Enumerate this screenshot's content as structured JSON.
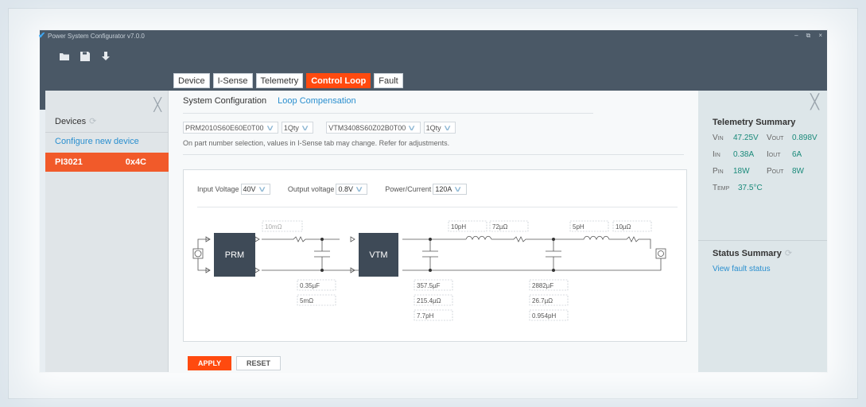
{
  "window": {
    "title": "Power System Configurator v7.0.0",
    "controls": [
      "–",
      "⧉",
      "×"
    ]
  },
  "toolbar": {
    "icons": [
      "folder-open-icon",
      "save-icon",
      "download-icon"
    ]
  },
  "tabs": [
    {
      "label": "Device"
    },
    {
      "label": "I-Sense"
    },
    {
      "label": "Telemetry"
    },
    {
      "label": "Control Loop",
      "active": true
    },
    {
      "label": "Fault"
    }
  ],
  "sidebar": {
    "title": "Devices",
    "configure_link": "Configure new device",
    "device": {
      "name": "PI3021",
      "address": "0x4C"
    }
  },
  "main": {
    "sub_tabs": [
      "System Configuration",
      "Loop Compensation"
    ],
    "selectors": {
      "prm_part": "PRM2010S60E60E0T00",
      "prm_qty": "1Qty",
      "vtm_part": "VTM3408S60Z02B0T00",
      "vtm_qty": "1Qty"
    },
    "note": "On part number selection, values in I-Sense tab may change. Refer for adjustments.",
    "inputs": {
      "input_voltage_label": "Input Voltage",
      "input_voltage": "40V",
      "output_voltage_label": "Output voltage",
      "output_voltage": "0.8V",
      "power_label": "Power/Current",
      "power": "120A"
    },
    "schematic": {
      "prm_label": "PRM",
      "vtm_label": "VTM",
      "r1": "10mΩ",
      "c1": "0.35µF",
      "esr1": "5mΩ",
      "c2": "357.5µF",
      "esr2": "215.4µΩ",
      "esl2": "7.7pH",
      "l3": "10pH",
      "r3": "72µΩ",
      "c4": "2882µF",
      "esr4": "26.7µΩ",
      "esl4": "0.954pH",
      "l5": "5pH",
      "r5": "10µΩ"
    },
    "apply_label": "APPLY",
    "reset_label": "RESET"
  },
  "right": {
    "telemetry_title": "Telemetry Summary",
    "telemetry": [
      {
        "l1": "Vin",
        "v1": "47.25V",
        "l2": "Vout",
        "v2": "0.898V"
      },
      {
        "l1": "Iin",
        "v1": "0.38A",
        "l2": "Iout",
        "v2": "6A"
      },
      {
        "l1": "Pin",
        "v1": "18W",
        "l2": "Pout",
        "v2": "8W"
      },
      {
        "l1": "Temp",
        "v1": "37.5°C"
      }
    ],
    "status_title": "Status Summary",
    "status_link": "View fault status"
  },
  "colors": {
    "accent": "#ff4a0f",
    "link": "#2a8fcf",
    "value": "#1a8a7a",
    "titlebar": "#4a5866"
  }
}
